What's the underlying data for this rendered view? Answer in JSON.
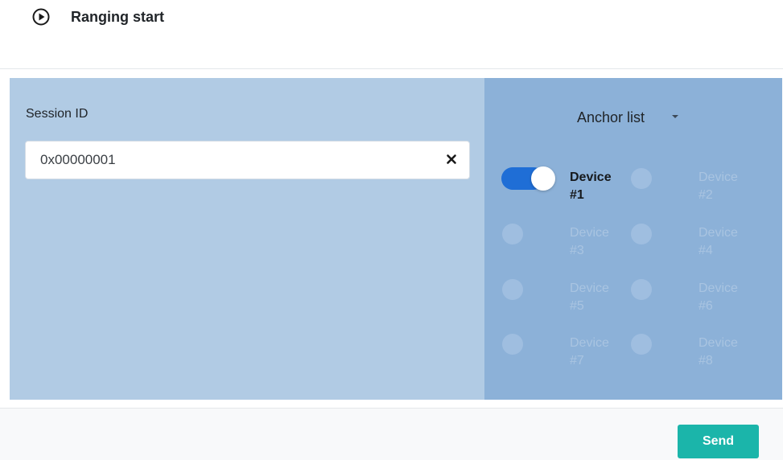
{
  "header": {
    "title": "Ranging start",
    "icon": "play-circle-icon"
  },
  "session": {
    "label": "Session ID",
    "value": "0x00000001",
    "clear_icon": "close-icon"
  },
  "anchors": {
    "title": "Anchor list",
    "devices": [
      {
        "line1": "Device",
        "line2": "#1",
        "enabled": true
      },
      {
        "line1": "Device",
        "line2": "#2",
        "enabled": false
      },
      {
        "line1": "Device",
        "line2": "#3",
        "enabled": false
      },
      {
        "line1": "Device",
        "line2": "#4",
        "enabled": false
      },
      {
        "line1": "Device",
        "line2": "#5",
        "enabled": false
      },
      {
        "line1": "Device",
        "line2": "#6",
        "enabled": false
      },
      {
        "line1": "Device",
        "line2": "#7",
        "enabled": false
      },
      {
        "line1": "Device",
        "line2": "#8",
        "enabled": false
      }
    ]
  },
  "footer": {
    "send_label": "Send"
  },
  "colors": {
    "accent": "#1bb5aa",
    "toggle_on": "#1f6ed6",
    "left_panel": "#b1cbe4",
    "right_panel": "#8cb1d8"
  }
}
